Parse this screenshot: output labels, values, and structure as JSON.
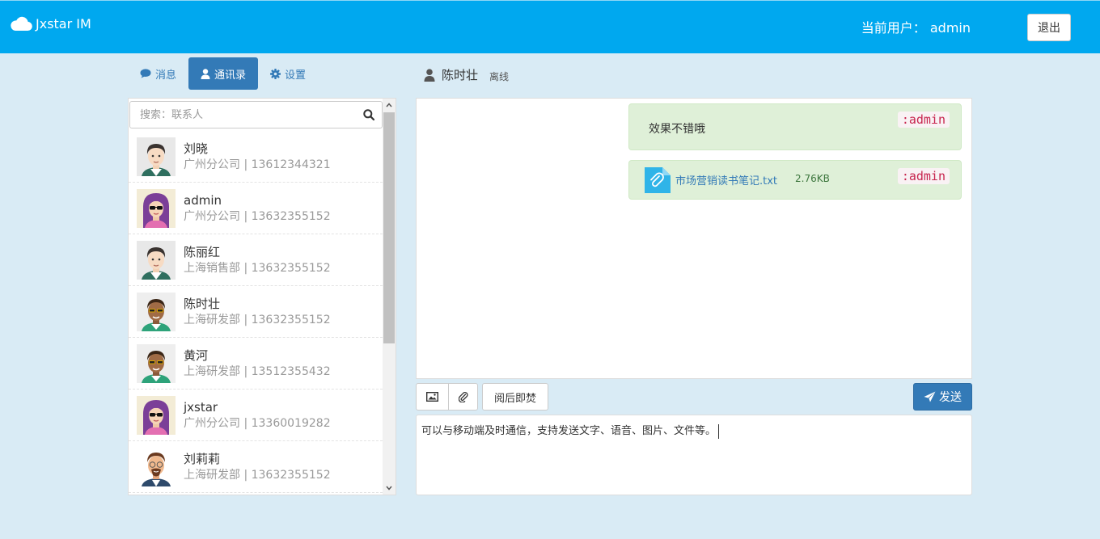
{
  "header": {
    "app_title": "Jxstar IM",
    "current_user_label": "当前用户：",
    "current_user_name": "admin",
    "logout_label": "退出",
    "bg_color": "#00a8ef"
  },
  "tabs": [
    {
      "label": "消息",
      "icon": "comment-icon",
      "active": false
    },
    {
      "label": "通讯录",
      "icon": "user-icon",
      "active": true
    },
    {
      "label": "设置",
      "icon": "gear-icon",
      "active": false
    }
  ],
  "search": {
    "placeholder": "搜索：联系人"
  },
  "contacts": [
    {
      "name": "刘晓",
      "dept": "广州分公司",
      "phone": "13612344321",
      "subtitle": "广州分公司 | 13612344321",
      "avatar": "man-avatar"
    },
    {
      "name": "admin",
      "dept": "广州分公司",
      "phone": "13632355152",
      "subtitle": "广州分公司 | 13632355152",
      "avatar": "woman-sunglasses-avatar"
    },
    {
      "name": "陈丽红",
      "dept": "上海销售部",
      "phone": "13632355152",
      "subtitle": "上海销售部 | 13632355152",
      "avatar": "man-avatar"
    },
    {
      "name": "陈时壮",
      "dept": "上海研发部",
      "phone": "13632355152",
      "subtitle": "上海研发部 | 13632355152",
      "avatar": "man-sunglasses-avatar"
    },
    {
      "name": "黄河",
      "dept": "上海研发部",
      "phone": "13512355432",
      "subtitle": "上海研发部 | 13512355432",
      "avatar": "man-sunglasses-avatar"
    },
    {
      "name": "jxstar",
      "dept": "广州分公司",
      "phone": "13360019282",
      "subtitle": "广州分公司 | 13360019282",
      "avatar": "woman-sunglasses-avatar"
    },
    {
      "name": "刘莉莉",
      "dept": "上海研发部",
      "phone": "13632355152",
      "subtitle": "上海研发部 | 13632355152",
      "avatar": "man-glasses-avatar"
    }
  ],
  "chat": {
    "name": "陈时壮",
    "status": "离线",
    "messages": [
      {
        "type": "text",
        "text": "效果不错哦",
        "sender": ":admin"
      },
      {
        "type": "file",
        "file_name": "市场营销读书笔记.txt",
        "file_size": "2.76KB",
        "sender": ":admin"
      }
    ]
  },
  "toolbar": {
    "image_icon": "image-icon",
    "attach_icon": "paperclip-icon",
    "burn_label": "阅后即焚",
    "send_label": "发送"
  },
  "compose": {
    "text": "可以与移动端及时通信，支持发送文字、语音、图片、文件等。"
  }
}
